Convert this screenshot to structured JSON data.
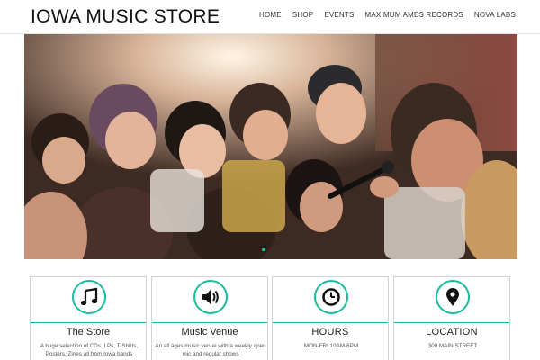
{
  "header": {
    "site_title": "IOWA MUSIC STORE",
    "nav": [
      "HOME",
      "SHOP",
      "EVENTS",
      "MAXIMUM AMES RECORDS",
      "NOVA LABS"
    ]
  },
  "hero": {
    "image": "crowd-with-microphone-photo",
    "slider_active_color": "#1abc9c"
  },
  "cards": [
    {
      "icon": "music-note-icon",
      "title": "The Store",
      "text": "A huge selection of CDs, LPs, T-Shirts, Posters, Zines all from Iowa bands"
    },
    {
      "icon": "volume-icon",
      "title": "Music Venue",
      "text": "An all ages music venue with a weekly open mic and regular shows"
    },
    {
      "icon": "clock-icon",
      "title": "HOURS",
      "text": "MON-FRI 10AM-6PM"
    },
    {
      "icon": "map-pin-icon",
      "title": "LOCATION",
      "text": "300 MAIN STREET"
    }
  ],
  "colors": {
    "accent": "#1abc9c",
    "border": "#cfd4d4",
    "text": "#222222"
  }
}
